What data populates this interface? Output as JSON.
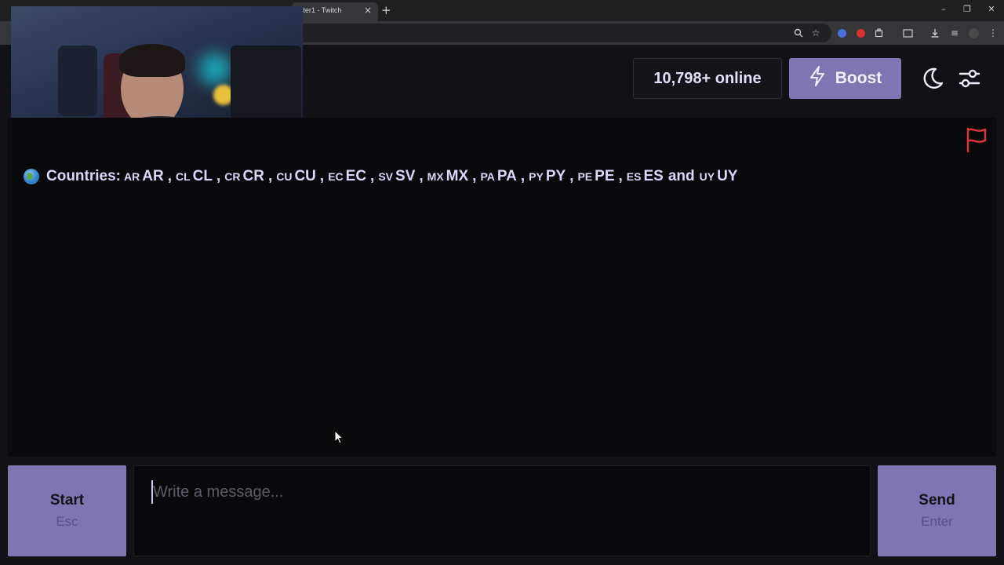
{
  "browser": {
    "tab_title": "ster1 - Twitch",
    "tab_close": "×",
    "new_tab": "+",
    "window_controls": {
      "minimize": "–",
      "restore": "❐",
      "close": "✕"
    }
  },
  "header": {
    "online_count": "10,798+ online",
    "boost_label": "Boost",
    "icons": [
      "lightning-icon",
      "moon-icon",
      "sliders-icon"
    ]
  },
  "chat": {
    "countries_label": "Countries:",
    "countries": [
      {
        "flag": "AR",
        "code": "AR"
      },
      {
        "flag": "CL",
        "code": "CL"
      },
      {
        "flag": "CR",
        "code": "CR"
      },
      {
        "flag": "CU",
        "code": "CU"
      },
      {
        "flag": "EC",
        "code": "EC"
      },
      {
        "flag": "SV",
        "code": "SV"
      },
      {
        "flag": "MX",
        "code": "MX"
      },
      {
        "flag": "PA",
        "code": "PA"
      },
      {
        "flag": "PY",
        "code": "PY"
      },
      {
        "flag": "PE",
        "code": "PE"
      },
      {
        "flag": "ES",
        "code": "ES"
      },
      {
        "flag": "UY",
        "code": "UY"
      }
    ],
    "separator": ",",
    "conjunction": "and",
    "flag_icon_color": "#e0353d"
  },
  "composer": {
    "start_label": "Start",
    "start_shortcut": "Esc",
    "placeholder": "Write a message...",
    "send_label": "Send",
    "send_shortcut": "Enter"
  },
  "colors": {
    "accent": "#7d76b3",
    "background": "#121115",
    "panel": "#09090b",
    "text": "#ddd6fb"
  }
}
